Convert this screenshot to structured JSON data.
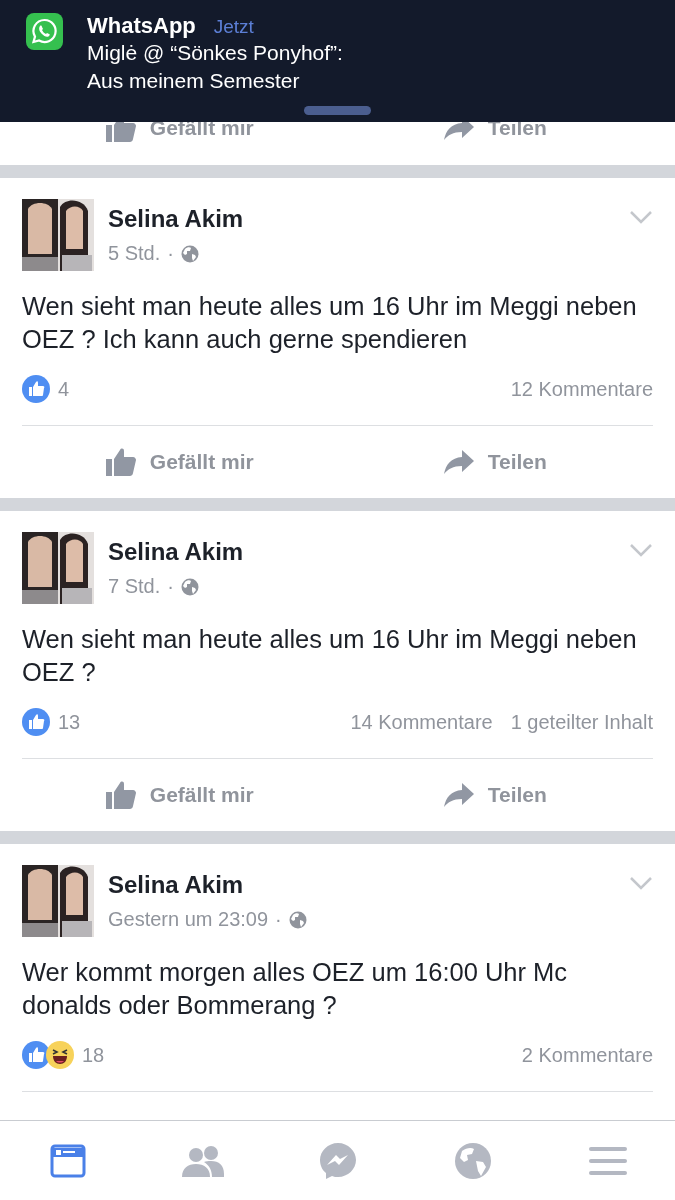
{
  "notification": {
    "app": "WhatsApp",
    "time": "Jetzt",
    "lines": [
      "Miglė @ “Sönkes Ponyhof”:",
      "Aus meinem Semester"
    ]
  },
  "top_actions": {
    "like": "Gefällt mir",
    "share": "Teilen"
  },
  "posts": [
    {
      "author": "Selina Akim",
      "time": "5 Std.",
      "separator": "·",
      "text": "Wen sieht man heute alles um 16 Uhr im Meggi neben OEZ ? Ich kann auch gerne spendieren",
      "reactions": [
        {
          "kind": "like"
        }
      ],
      "reaction_count": "4",
      "stats": [
        "12 Kommentare"
      ],
      "actions": {
        "like": "Gefällt mir",
        "share": "Teilen"
      }
    },
    {
      "author": "Selina Akim",
      "time": "7 Std.",
      "separator": "·",
      "text": "Wen sieht man heute alles um 16 Uhr im Meggi neben OEZ ?",
      "reactions": [
        {
          "kind": "like"
        }
      ],
      "reaction_count": "13",
      "stats": [
        "14 Kommentare",
        "1 geteilter Inhalt"
      ],
      "actions": {
        "like": "Gefällt mir",
        "share": "Teilen"
      }
    },
    {
      "author": "Selina Akim",
      "time": "Gestern um 23:09",
      "separator": "·",
      "text": "Wer kommt morgen alles OEZ um 16:00 Uhr Mc donalds oder Bommerang ?",
      "reactions": [
        {
          "kind": "like"
        },
        {
          "kind": "haha"
        }
      ],
      "reaction_count": "18",
      "stats": [
        "2 Kommentare"
      ]
    }
  ],
  "tab_bar": [
    {
      "kind": "feed",
      "selected": true
    },
    {
      "kind": "friends",
      "selected": false
    },
    {
      "kind": "messenger",
      "selected": false
    },
    {
      "kind": "globe",
      "selected": false
    },
    {
      "kind": "menu",
      "selected": false
    }
  ]
}
